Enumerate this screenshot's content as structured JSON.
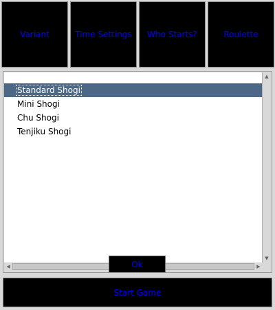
{
  "tabs": [
    {
      "label": "Variant"
    },
    {
      "label": "Time Settings"
    },
    {
      "label": "Who Starts?"
    },
    {
      "label": "Roulette"
    }
  ],
  "variant_list": {
    "items": [
      "Standard Shogi",
      "Mini Shogi",
      "Chu Shogi",
      "Tenjiku Shogi"
    ],
    "selected": "Standard Shogi"
  },
  "ok_button": {
    "label": "Ok"
  },
  "start_button": {
    "label": "Start Game"
  },
  "colors": {
    "button_bg": "#000000",
    "button_text": "#0000ff",
    "selection_bg": "#4c6886",
    "window_bg": "#d9d9d9"
  }
}
